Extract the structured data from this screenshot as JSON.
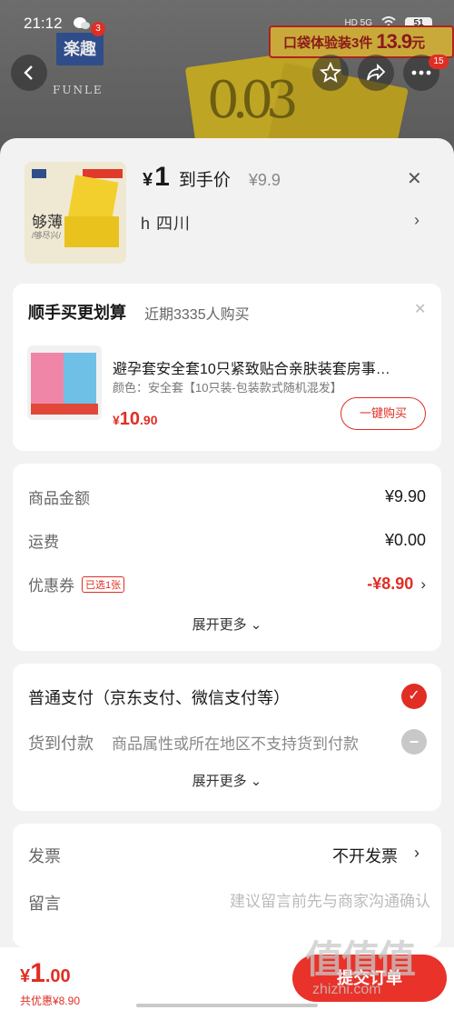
{
  "status_bar": {
    "time": "21:12",
    "wechat_badge": "3",
    "battery": "51"
  },
  "background": {
    "brand_logo": "楽趣",
    "brand_name": "FUNLE",
    "promo_text": "口袋体验装3件",
    "promo_price": "13.9",
    "promo_unit": "元",
    "more_badge": "15"
  },
  "header": {
    "currency": "¥",
    "price": "1",
    "arrive_label": "到手价",
    "original_price": "¥9.9",
    "address": "h 四川",
    "thumb_text": "够薄",
    "thumb_sub": "/够尽兴/"
  },
  "upsell": {
    "title": "顺手买更划算",
    "subtitle": "近期3335人购买",
    "product_name": "避孕套安全套10只紧致贴合亲肤装套房事…",
    "spec": "颜色：安全套【10只装-包装款式随机混发】",
    "price_yen": "¥",
    "price_int": "10",
    "price_dec": ".90",
    "buy_label": "一键购买"
  },
  "summary": {
    "items": [
      {
        "label": "商品金额",
        "value": "¥9.90"
      },
      {
        "label": "运费",
        "value": "¥0.00"
      },
      {
        "label": "优惠券",
        "tag": "已选1张",
        "value": "-¥8.90"
      }
    ],
    "expand_label": "展开更多"
  },
  "payment": {
    "option1": "普通支付（京东支付、微信支付等）",
    "option2": "货到付款",
    "option2_reason": "商品属性或所在地区不支持货到付款",
    "expand_label": "展开更多"
  },
  "extras": {
    "invoice_label": "发票",
    "invoice_value": "不开发票",
    "message_label": "留言",
    "message_placeholder": "建议留言前先与商家沟通确认"
  },
  "bottom_bar": {
    "total_yen": "¥",
    "total_int": "1",
    "total_dec": ".00",
    "saving": "共优惠¥8.90",
    "submit_label": "提交订单"
  },
  "watermark": {
    "main": "值值值",
    "sub": "zhizhi.com"
  },
  "colors": {
    "accent": "#e02e24",
    "sheet_bg": "#f2f2f2",
    "card_bg": "#ffffff"
  }
}
